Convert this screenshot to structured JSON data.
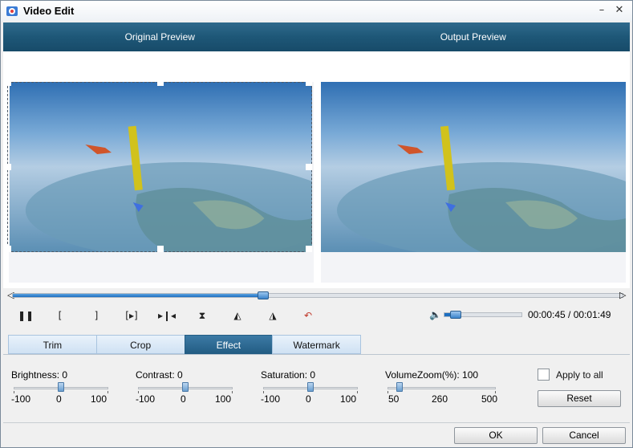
{
  "window": {
    "title": "Video Edit",
    "minimize_glyph": "–",
    "close_glyph": "✕"
  },
  "preview": {
    "original_label": "Original Preview",
    "output_label": "Output Preview"
  },
  "playback": {
    "progress": 0.41,
    "current_time": "00:00:45",
    "total_time": "00:01:49",
    "time_separator": " / ",
    "volume": 0.15
  },
  "controls": {
    "icons": [
      "pause-icon",
      "mark-in-icon",
      "mark-out-icon",
      "next-frame-icon",
      "skip-to-end-icon",
      "flip-vertical-icon",
      "rotate-left-icon",
      "rotate-right-icon",
      "undo-icon"
    ]
  },
  "tabs": [
    {
      "label": "Trim",
      "active": false
    },
    {
      "label": "Crop",
      "active": false
    },
    {
      "label": "Effect",
      "active": true
    },
    {
      "label": "Watermark",
      "active": false
    }
  ],
  "effect": {
    "brightness": {
      "label": "Brightness:",
      "value": "0",
      "min": "-100",
      "mid": "0",
      "max": "100",
      "pos": 0.5
    },
    "contrast": {
      "label": "Contrast:",
      "value": "0",
      "min": "-100",
      "mid": "0",
      "max": "100",
      "pos": 0.5
    },
    "saturation": {
      "label": "Saturation:",
      "value": "0",
      "min": "-100",
      "mid": "0",
      "max": "100",
      "pos": 0.5
    },
    "volumezoom": {
      "label": "VolumeZoom(%):",
      "value": "100",
      "min": "50",
      "mid": "260",
      "max": "500",
      "pos": 0.11
    }
  },
  "apply_to_all": {
    "label": "Apply to all",
    "checked": false
  },
  "buttons": {
    "reset": "Reset",
    "ok": "OK",
    "cancel": "Cancel"
  },
  "colors": {
    "accent": "#235d84",
    "header_bar": "#1e5777",
    "progress": "#1e6fc0"
  }
}
